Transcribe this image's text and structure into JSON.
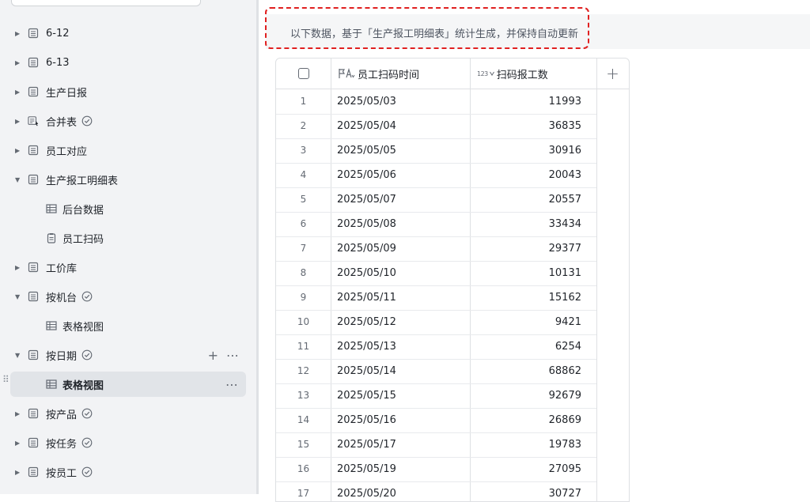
{
  "sidebar": {
    "items": [
      {
        "label": "6-12",
        "expanded": false,
        "icon": "sheet-icon",
        "sync": false
      },
      {
        "label": "6-13",
        "expanded": false,
        "icon": "sheet-icon",
        "sync": false
      },
      {
        "label": "生产日报",
        "expanded": false,
        "icon": "sheet-icon",
        "sync": false
      },
      {
        "label": "合并表",
        "expanded": false,
        "icon": "merged-sheet-icon",
        "sync": true
      },
      {
        "label": "员工对应",
        "expanded": false,
        "icon": "sheet-icon",
        "sync": false
      },
      {
        "label": "生产报工明细表",
        "expanded": true,
        "icon": "sheet-icon",
        "sync": false
      },
      {
        "label": "后台数据",
        "child": true,
        "icon": "grid-view-icon"
      },
      {
        "label": "员工扫码",
        "child": true,
        "icon": "form-view-icon"
      },
      {
        "label": "工价库",
        "expanded": false,
        "icon": "sheet-icon",
        "sync": false
      },
      {
        "label": "按机台",
        "expanded": true,
        "icon": "sheet-icon",
        "sync": true
      },
      {
        "label": "表格视图",
        "child": true,
        "icon": "grid-view-icon"
      },
      {
        "label": "按日期",
        "expanded": true,
        "icon": "sheet-icon",
        "sync": true
      },
      {
        "label": "表格视图",
        "child": true,
        "icon": "grid-view-icon",
        "active": true
      },
      {
        "label": "按产品",
        "expanded": false,
        "icon": "sheet-icon",
        "sync": true
      },
      {
        "label": "按任务",
        "expanded": false,
        "icon": "sheet-icon",
        "sync": true
      },
      {
        "label": "按员工",
        "expanded": false,
        "icon": "sheet-icon",
        "sync": true
      }
    ]
  },
  "notice": {
    "text": "以下数据，基于「生产报工明细表」统计生成，并保持自动更新"
  },
  "table": {
    "columns": [
      {
        "label": "员工扫码时间",
        "icon": "flag-formula-icon"
      },
      {
        "label": "扫码报工数",
        "icon": "number-formula-icon",
        "icon_text": "123"
      }
    ],
    "rows": [
      {
        "idx": "1",
        "date": "2025/05/03",
        "count": "11993"
      },
      {
        "idx": "2",
        "date": "2025/05/04",
        "count": "36835"
      },
      {
        "idx": "3",
        "date": "2025/05/05",
        "count": "30916"
      },
      {
        "idx": "4",
        "date": "2025/05/06",
        "count": "20043"
      },
      {
        "idx": "5",
        "date": "2025/05/07",
        "count": "20557"
      },
      {
        "idx": "6",
        "date": "2025/05/08",
        "count": "33434"
      },
      {
        "idx": "7",
        "date": "2025/05/09",
        "count": "29377"
      },
      {
        "idx": "8",
        "date": "2025/05/10",
        "count": "10131"
      },
      {
        "idx": "9",
        "date": "2025/05/11",
        "count": "15162"
      },
      {
        "idx": "10",
        "date": "2025/05/12",
        "count": "9421"
      },
      {
        "idx": "11",
        "date": "2025/05/13",
        "count": "6254"
      },
      {
        "idx": "12",
        "date": "2025/05/14",
        "count": "68862"
      },
      {
        "idx": "13",
        "date": "2025/05/15",
        "count": "92679"
      },
      {
        "idx": "14",
        "date": "2025/05/16",
        "count": "26869"
      },
      {
        "idx": "15",
        "date": "2025/05/17",
        "count": "19783"
      },
      {
        "idx": "16",
        "date": "2025/05/19",
        "count": "27095"
      },
      {
        "idx": "17",
        "date": "2025/05/20",
        "count": "30727"
      }
    ]
  },
  "colors": {
    "sidebar_bg": "#f2f3f5",
    "active_bg": "#e1e4e8",
    "highlight_border": "#e02020",
    "sync_icon": "#646a73"
  }
}
